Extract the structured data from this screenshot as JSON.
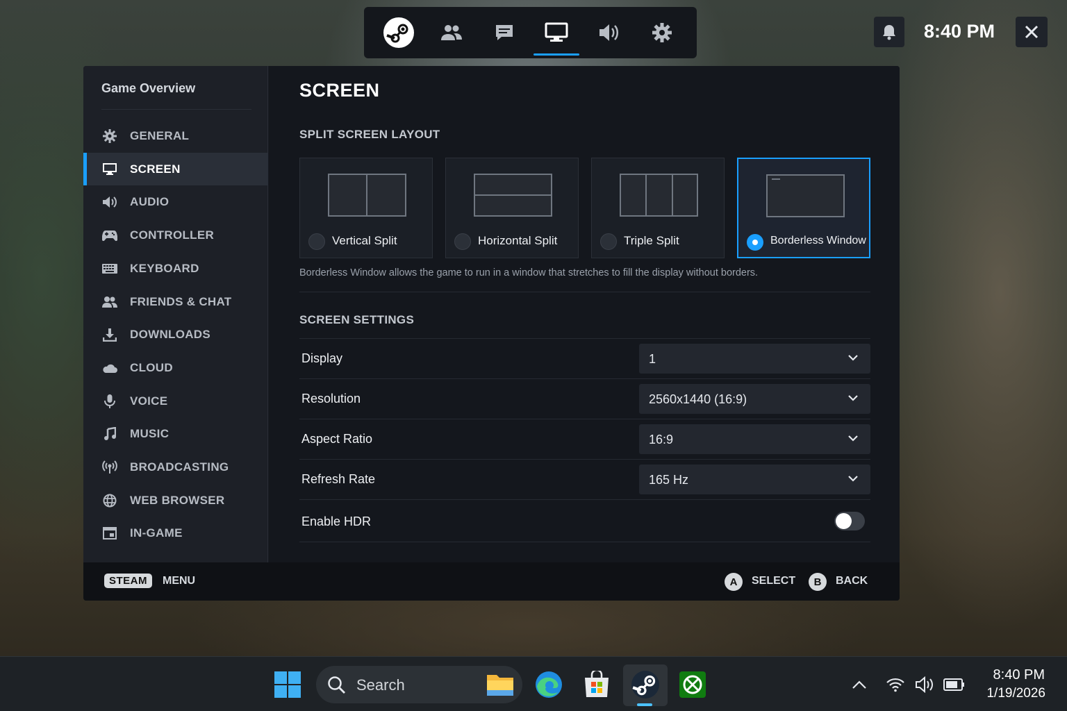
{
  "overlay": {
    "quick_access": [
      "steam-icon",
      "friends-icon",
      "chat-icon",
      "display-icon",
      "volume-icon",
      "settings-icon"
    ],
    "active_tab": "display-icon",
    "time": "8:40 PM"
  },
  "sidebar": {
    "title": "Game Overview",
    "items": [
      {
        "label": "GENERAL",
        "icon": "gear-icon"
      },
      {
        "label": "SCREEN",
        "icon": "monitor-icon"
      },
      {
        "label": "AUDIO",
        "icon": "speaker-icon"
      },
      {
        "label": "CONTROLLER",
        "icon": "gamepad-icon"
      },
      {
        "label": "KEYBOARD",
        "icon": "keyboard-icon"
      },
      {
        "label": "FRIENDS & CHAT",
        "icon": "friends-icon"
      },
      {
        "label": "DOWNLOADS",
        "icon": "download-icon"
      },
      {
        "label": "CLOUD",
        "icon": "cloud-icon"
      },
      {
        "label": "VOICE",
        "icon": "microphone-icon"
      },
      {
        "label": "MUSIC",
        "icon": "music-note-icon"
      },
      {
        "label": "BROADCASTING",
        "icon": "broadcast-icon"
      },
      {
        "label": "WEB BROWSER",
        "icon": "globe-icon"
      },
      {
        "label": "IN-GAME",
        "icon": "window-icon"
      }
    ],
    "active": "SCREEN"
  },
  "main": {
    "title": "SCREEN",
    "split_section": "SPLIT SCREEN LAYOUT",
    "layouts": [
      {
        "label": "Vertical Split",
        "selected": false
      },
      {
        "label": "Horizontal Split",
        "selected": false
      },
      {
        "label": "Triple Split",
        "selected": false
      },
      {
        "label": "Borderless Window",
        "selected": true
      }
    ],
    "description": "Borderless Window allows the game to run in a window that stretches to fill the display without borders.",
    "settings_section": "SCREEN SETTINGS",
    "settings": [
      {
        "label": "Display",
        "value": "1"
      },
      {
        "label": "Resolution",
        "value": "2560x1440 (16:9)"
      },
      {
        "label": "Aspect Ratio",
        "value": "16:9"
      },
      {
        "label": "Refresh Rate",
        "value": "165 Hz"
      }
    ],
    "hdr": {
      "label": "Enable HDR",
      "enabled": false
    }
  },
  "footer": {
    "steam_badge": "STEAM",
    "menu": "MENU",
    "a_key": "A",
    "select": "SELECT",
    "b_key": "B",
    "back": "BACK"
  },
  "taskbar": {
    "search_placeholder": "Search",
    "time": "8:40 PM",
    "date": "1/19/2026"
  },
  "colors": {
    "accent": "#1a9fff",
    "panel": "#171a21",
    "taskbar": "#1e2226"
  }
}
